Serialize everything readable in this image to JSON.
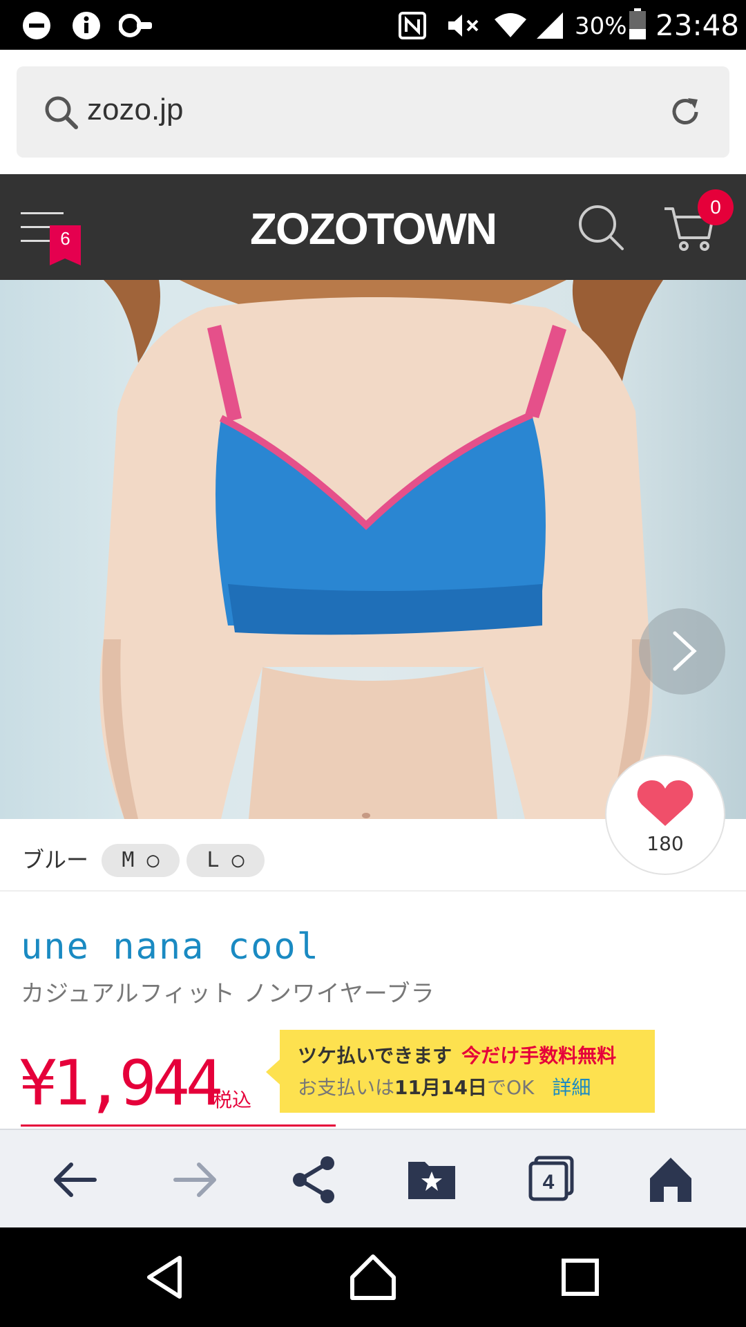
{
  "status_bar": {
    "icons": [
      "minus-circle-icon",
      "info-icon",
      "key-icon",
      "nfc-icon",
      "mute-icon",
      "wifi-icon",
      "signal-icon",
      "battery-icon"
    ],
    "battery_percent": "30%",
    "time": "23:48"
  },
  "url_bar": {
    "url": "zozo.jp",
    "icons": [
      "search-icon",
      "reload-icon"
    ]
  },
  "site_header": {
    "logo": "ZOZOTOWN",
    "menu_badge": "6",
    "cart_count": "0",
    "icons": [
      "hamburger-menu-icon",
      "search-icon",
      "cart-icon"
    ]
  },
  "product": {
    "favorite_count": "180",
    "color_name": "ブルー",
    "sizes": [
      {
        "label": "M ○"
      },
      {
        "label": "L ○"
      }
    ],
    "brand": "une nana cool",
    "name": "カジュアルフィット ノンワイヤーブラ",
    "price": "¥1,944",
    "tax_label": "税込"
  },
  "tsuke_banner": {
    "line1_main": "ツケ払いできます",
    "line1_promo": "今だけ手数料無料",
    "line2_prefix": "お支払いは",
    "line2_date": "11月14日",
    "line2_suffix": "でOK",
    "detail_link": "詳細"
  },
  "browser_nav": {
    "tabs_count": "4",
    "icons": [
      "back-arrow-icon",
      "forward-arrow-icon",
      "share-icon",
      "bookmarks-icon",
      "tabs-icon",
      "home-icon"
    ]
  },
  "system_nav": {
    "icons": [
      "back-triangle-icon",
      "home-circle-icon",
      "recents-square-icon"
    ]
  },
  "colors": {
    "header_bg": "#333333",
    "accent_red": "#e5003a",
    "link_blue": "#1a8ac2",
    "banner_yellow": "#fde14f",
    "product_blue": "#2a86d2",
    "strap_pink": "#e5508a"
  }
}
